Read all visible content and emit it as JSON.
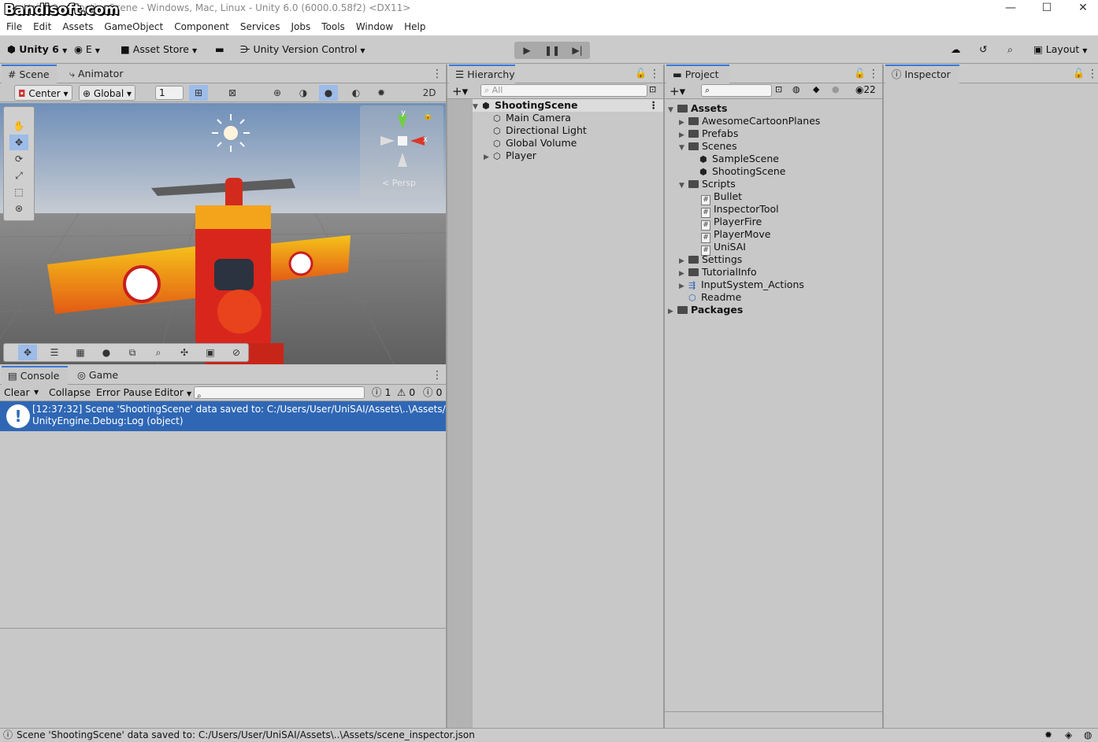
{
  "window": {
    "title": "Unity 6 - ShootingScene - Windows, Mac, Linux - Unity 6.0 (6000.0.58f2) <DX11>",
    "watermark": "Bandisoft.com",
    "minimize": "—",
    "maximize": "☐",
    "close": "✕"
  },
  "menu": [
    "File",
    "Edit",
    "Assets",
    "GameObject",
    "Component",
    "Services",
    "Jobs",
    "Tools",
    "Window",
    "Help"
  ],
  "toolbar": {
    "unity_label": "Unity 6",
    "account_label": "E",
    "asset_store": "Asset Store",
    "version_control": "Unity Version Control",
    "layout": "Layout"
  },
  "scene_panel": {
    "tabs": [
      "Scene",
      "Animator"
    ],
    "pivot": "Center",
    "space": "Global",
    "grid_value": "1",
    "persp_label": "< Persp",
    "axis_y": "y",
    "axis_x": "x"
  },
  "console_panel": {
    "tabs": [
      "Console",
      "Game"
    ],
    "buttons": [
      "Clear",
      "Collapse",
      "Error Pause",
      "Editor"
    ],
    "counts": {
      "info": "1",
      "warn": "0",
      "error": "0"
    },
    "log_line1": "[12:37:32] Scene 'ShootingScene' data saved to: C:/Users/User/UniSAI/Assets\\..\\Assets/scer",
    "log_line2": "UnityEngine.Debug:Log (object)"
  },
  "hierarchy": {
    "tab": "Hierarchy",
    "search_placeholder": "All",
    "scene": "ShootingScene",
    "items": [
      "Main Camera",
      "Directional Light",
      "Global Volume",
      "Player"
    ]
  },
  "project": {
    "tab": "Project",
    "hidden_count": "22",
    "tree": {
      "assets": "Assets",
      "awesome": "AwesomeCartoonPlanes",
      "prefabs": "Prefabs",
      "scenes": "Scenes",
      "sample_scene": "SampleScene",
      "shooting_scene": "ShootingScene",
      "scripts": "Scripts",
      "bullet": "Bullet",
      "inspector_tool": "InspectorTool",
      "player_fire": "PlayerFire",
      "player_move": "PlayerMove",
      "unisai": "UniSAI",
      "settings": "Settings",
      "tutorial": "TutorialInfo",
      "input_actions": "InputSystem_Actions",
      "readme": "Readme",
      "packages": "Packages"
    }
  },
  "inspector": {
    "tab": "Inspector"
  },
  "status": {
    "message": "Scene 'ShootingScene' data saved to: C:/Users/User/UniSAI/Assets\\..\\Assets/scene_inspector.json"
  },
  "colors": {
    "accent": "#3a79d8",
    "selection": "#2f67b5",
    "sky_top": "#6f8fb8",
    "ground": "#6d6d6d"
  }
}
